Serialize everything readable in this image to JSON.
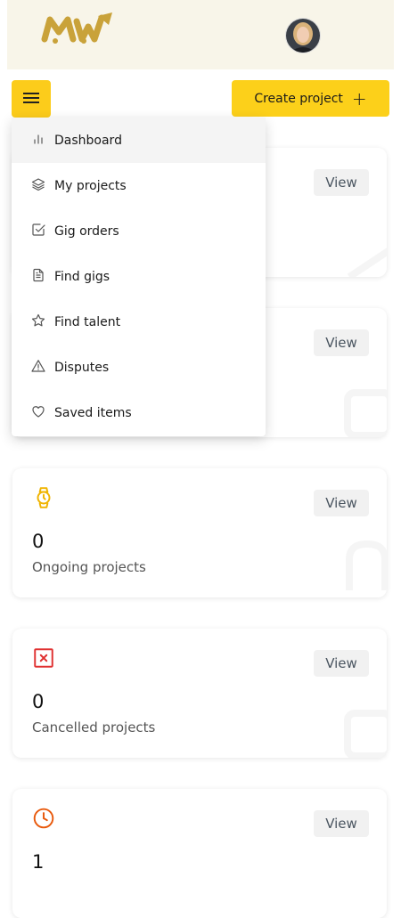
{
  "header": {
    "logo_text": "MW"
  },
  "toolbar": {
    "create_label": "Create project",
    "create_icon": "plus-icon"
  },
  "menu": {
    "items": [
      {
        "label": "Dashboard",
        "icon": "bar-chart-icon",
        "active": true
      },
      {
        "label": "My projects",
        "icon": "layers-icon"
      },
      {
        "label": "Gig orders",
        "icon": "check-square-icon"
      },
      {
        "label": "Find gigs",
        "icon": "file-text-icon"
      },
      {
        "label": "Find talent",
        "icon": "star-icon"
      },
      {
        "label": "Disputes",
        "icon": "alert-triangle-icon"
      },
      {
        "label": "Saved items",
        "icon": "heart-icon"
      }
    ]
  },
  "cards": [
    {
      "view_label": "View"
    },
    {
      "view_label": "View"
    },
    {
      "count": "0",
      "label": "Ongoing projects",
      "view_label": "View",
      "icon": "watch-icon",
      "icon_color": "#f0b400"
    },
    {
      "count": "0",
      "label": "Cancelled projects",
      "view_label": "View",
      "icon": "x-square-icon",
      "icon_color": "#e03131"
    },
    {
      "count": "1",
      "label": "",
      "view_label": "View",
      "icon": "clock-icon",
      "icon_color": "#e8590c"
    }
  ],
  "colors": {
    "accent": "#fccc1b",
    "header_bg": "#f8f5e9",
    "logo": "#c9a23a"
  }
}
